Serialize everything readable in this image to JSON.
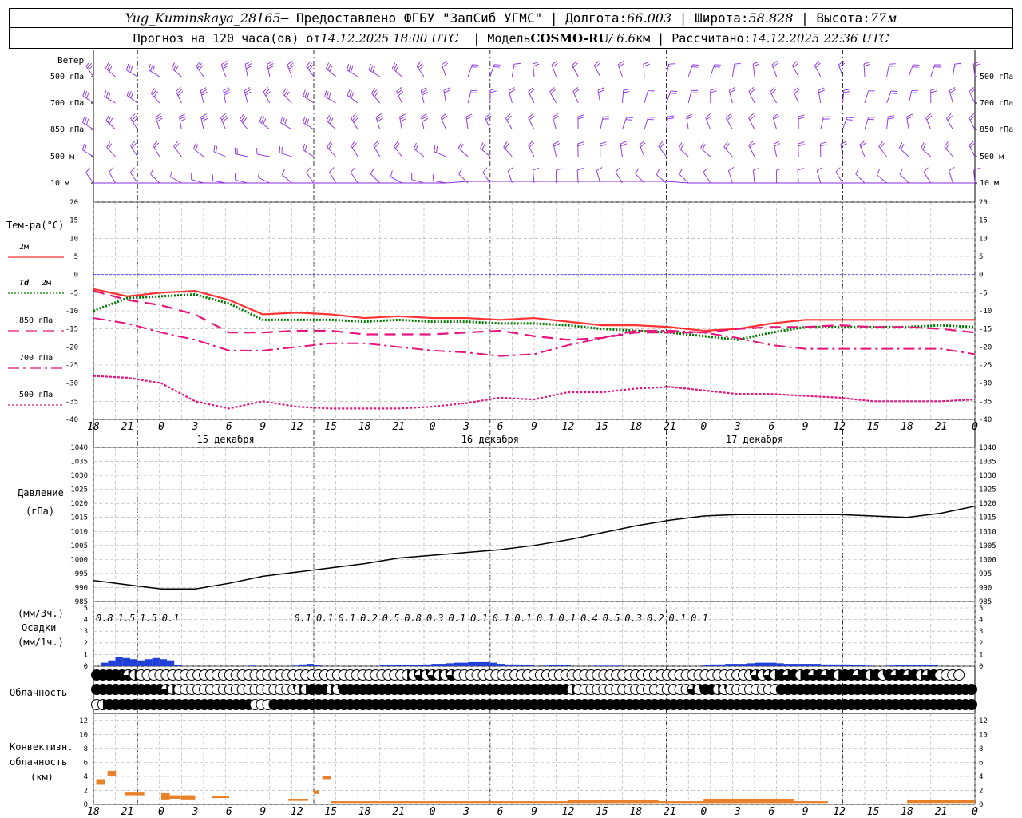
{
  "header": {
    "station": "Yug_Kuminskaya_28165",
    "provider": "— Предоставлено ФГБУ \"ЗапСиб УГМС\"",
    "lon_label": "Долгота:",
    "lon": "66.003",
    "lat_label": "Широта:",
    "lat": "58.828",
    "alt_label": "Высота:",
    "alt": "77м",
    "forecast_prefix": "Прогноз на 120 часа(ов) от",
    "forecast_time": "14.12.2025 18:00 UTC",
    "model_label": "Модель",
    "model": "COSMO-RU",
    "resolution": "/ 6.6",
    "resolution_unit": "км",
    "calc_label": "Рассчитано:",
    "calc_time": "14.12.2025 22:36 UTC"
  },
  "colors": {
    "wind": "#8a2be2",
    "t2m": "#ff3333",
    "td2m": "#007700",
    "t850": "#e6157d",
    "t700": "#e6157d",
    "t500": "#e6157d",
    "zero_line": "#3a3aff",
    "pressure": "#000000",
    "precip": "#1f3fd6",
    "convective": "#e8822a"
  },
  "icons": {
    "cloud_cover": "circle-fill-fraction",
    "wind": "wind-barb"
  },
  "chart_data": {
    "x_hours": [
      18,
      21,
      0,
      3,
      6,
      9,
      12,
      15,
      18,
      21,
      0,
      3,
      6,
      9,
      12,
      15,
      18,
      21,
      0,
      3,
      6,
      9,
      12,
      15,
      18,
      21,
      0
    ],
    "x_labels": [
      "18",
      "21",
      "0",
      "3",
      "6",
      "9",
      "12",
      "15",
      "18",
      "21",
      "0",
      "3",
      "6",
      "9",
      "12",
      "15",
      "18",
      "21",
      "0",
      "3",
      "6",
      "9",
      "12",
      "15",
      "18",
      "21",
      "0"
    ],
    "day_labels": [
      "15 декабря",
      "16 декабря",
      "17 декабря"
    ],
    "wind": {
      "title": "Ветер",
      "levels": [
        "500 гПа",
        "700 гПа",
        "850 гПа",
        "500 м",
        "10  м"
      ]
    },
    "temperature": {
      "type": "line",
      "title": "Тем-ра(°C)",
      "ylim": [
        -40,
        20
      ],
      "yticks": [
        20,
        15,
        10,
        5,
        0,
        -5,
        -10,
        -15,
        -20,
        -25,
        -30,
        -35,
        -40
      ],
      "legend": [
        {
          "name": "2м",
          "prefix": "",
          "style": "solid"
        },
        {
          "name": "2м",
          "prefix": "Td",
          "style": "dotted"
        },
        {
          "name": "850 гПа",
          "prefix": "",
          "style": "dash"
        },
        {
          "name": "700 гПа",
          "prefix": "",
          "style": "dashdot"
        },
        {
          "name": "500 гПа",
          "prefix": "",
          "style": "fine"
        }
      ],
      "series": {
        "t2m": [
          -4,
          -6,
          -5,
          -4.5,
          -7,
          -11,
          -10.5,
          -11,
          -12,
          -11.5,
          -12,
          -12,
          -12.5,
          -12,
          -13,
          -14,
          -14,
          -14.5,
          -15.5,
          -15,
          -13.5,
          -12.5,
          -12.5,
          -12.5,
          -12.5,
          -12.5,
          -12.5
        ],
        "td2m": [
          -10,
          -6.5,
          -6,
          -5.5,
          -8,
          -12.5,
          -12.5,
          -12.5,
          -13,
          -12.5,
          -13,
          -13,
          -13.5,
          -13.5,
          -14,
          -15,
          -15.5,
          -16,
          -17,
          -18,
          -16,
          -14.5,
          -14.5,
          -14.5,
          -14.5,
          -14,
          -14.5
        ],
        "t850": [
          -4.5,
          -7,
          -8.5,
          -11,
          -16,
          -16,
          -15.5,
          -15.5,
          -16.5,
          -16.5,
          -16.5,
          -16,
          -15.5,
          -17,
          -18,
          -17.5,
          -16,
          -16,
          -16,
          -15,
          -14.5,
          -14.5,
          -14,
          -14.5,
          -14.5,
          -15,
          -16
        ],
        "t700": [
          -12,
          -13.5,
          -16,
          -18,
          -21,
          -21,
          -20,
          -19,
          -19,
          -20,
          -21,
          -21.5,
          -22.5,
          -22,
          -19.5,
          -17.5,
          -15.5,
          -15.5,
          -16,
          -17.5,
          -19.5,
          -20.5,
          -20.5,
          -20.5,
          -20.5,
          -20.5,
          -22
        ],
        "t500": [
          -28,
          -28.5,
          -30,
          -35,
          -37,
          -35,
          -36.5,
          -37,
          -37,
          -37,
          -36.5,
          -35.5,
          -34,
          -34.5,
          -32.5,
          -32.5,
          -31.5,
          -31,
          -32,
          -33,
          -33,
          -33.5,
          -34,
          -35,
          -35,
          -35,
          -34.5
        ]
      }
    },
    "pressure": {
      "type": "line",
      "title": "Давление",
      "unit": "(гПа)",
      "ylim": [
        985,
        1040
      ],
      "yticks": [
        1040,
        1035,
        1030,
        1025,
        1020,
        1015,
        1010,
        1005,
        1000,
        995,
        990,
        985
      ],
      "values": [
        992.5,
        991,
        989.5,
        989.5,
        991.5,
        994,
        995.5,
        997,
        998.5,
        1000.5,
        1001.5,
        1002.5,
        1003.5,
        1005,
        1007,
        1009.5,
        1012,
        1014,
        1015.5,
        1016,
        1016,
        1016,
        1016,
        1015.5,
        1015,
        1016.5,
        1019
      ]
    },
    "precipitation": {
      "type": "bar",
      "unit_3h": "(мм/3ч.)",
      "title": "Осадки",
      "unit_1h": "(мм/1ч.)",
      "ylim": [
        0,
        5
      ],
      "yticks": [
        5,
        4,
        3,
        2,
        1,
        0
      ],
      "amount_labels": [
        "0.8",
        "1.5",
        "1.5",
        "0.1",
        "",
        "",
        "",
        "",
        "",
        "0.1",
        "0.1",
        "0.1",
        "0.2",
        "0.5",
        "0.8",
        "0.3",
        "0.1",
        "0.1",
        "0.1",
        "0.1",
        "0.1",
        "0.1",
        "0.4",
        "0.5",
        "0.3",
        "0.2",
        "0.1",
        "0.1"
      ],
      "hourly": [
        0,
        0.3,
        0.5,
        0.8,
        0.7,
        0.6,
        0.5,
        0.6,
        0.7,
        0.6,
        0.5,
        0.1,
        0,
        0,
        0,
        0,
        0,
        0,
        0,
        0,
        0,
        0.05,
        0,
        0,
        0,
        0,
        0,
        0.05,
        0.15,
        0.2,
        0.1,
        0,
        0,
        0,
        0,
        0,
        0,
        0,
        0,
        0.1,
        0.1,
        0.1,
        0.1,
        0.1,
        0.1,
        0.15,
        0.2,
        0.2,
        0.25,
        0.3,
        0.3,
        0.35,
        0.35,
        0.35,
        0.3,
        0.2,
        0.15,
        0.15,
        0.1,
        0.1,
        0,
        0.05,
        0.1,
        0.1,
        0.1,
        0,
        0,
        0,
        0.05,
        0.05,
        0.05,
        0.05,
        0,
        0,
        0,
        0,
        0,
        0,
        0,
        0,
        0,
        0,
        0,
        0.1,
        0.15,
        0.15,
        0.2,
        0.2,
        0.2,
        0.25,
        0.3,
        0.3,
        0.3,
        0.25,
        0.2,
        0.2,
        0.2,
        0.2,
        0.2,
        0.15,
        0.15,
        0.15,
        0.15,
        0.1,
        0.1,
        0.05,
        0,
        0,
        0.05,
        0.1,
        0.1,
        0.1,
        0.1,
        0.1,
        0.1
      ]
    },
    "cloud": {
      "title": "Облачность",
      "rows": [
        [
          1,
          1,
          1,
          1,
          1,
          0.75,
          0.5,
          0,
          0,
          0,
          0,
          0,
          0,
          0,
          0,
          0,
          0,
          0,
          0,
          0,
          0,
          0,
          0,
          0,
          0,
          0,
          0,
          0,
          0,
          0,
          0,
          0,
          0,
          0,
          0,
          0,
          0,
          0,
          0,
          0,
          0,
          0,
          0,
          0,
          0,
          0,
          0,
          0,
          0,
          0.5,
          0.25,
          0.75,
          0.25,
          0.75,
          0.5,
          0.25,
          0.75,
          0,
          0,
          0,
          0,
          0,
          0,
          0,
          0,
          0,
          0,
          0,
          0,
          0,
          0,
          0,
          0,
          0,
          0,
          0,
          0,
          0,
          0,
          0,
          0,
          0,
          0,
          0,
          0,
          0,
          0,
          0,
          0,
          0,
          0,
          0,
          0,
          0,
          0,
          0,
          0,
          0,
          0,
          0,
          0,
          0,
          0,
          0.25,
          0.75,
          0.25,
          0.75,
          0.5,
          1,
          0.75,
          1,
          0.5,
          1,
          0.75,
          1,
          0.75,
          1,
          0.5,
          1,
          1,
          0.75,
          1,
          0.5,
          1,
          0.25,
          1,
          0.75,
          1,
          0.75,
          1,
          0.5,
          0.75,
          1,
          0,
          0,
          0,
          0
        ],
        [
          1,
          1,
          1,
          1,
          1,
          1,
          1,
          1,
          1,
          1,
          1,
          0.75,
          0.5,
          0,
          0,
          0,
          0,
          0,
          0,
          0,
          0,
          0,
          0,
          0,
          0,
          0,
          0,
          0,
          0,
          0,
          0,
          0.25,
          0.5,
          0.5,
          1,
          1,
          1,
          0.5,
          0.25,
          1,
          1,
          1,
          1,
          1,
          1,
          1,
          1,
          1,
          1,
          1,
          1,
          1,
          1,
          1,
          1,
          1,
          1,
          1,
          1,
          1,
          1,
          1,
          1,
          1,
          1,
          1,
          1,
          1,
          1,
          1,
          1,
          1,
          1,
          1,
          1,
          0.5,
          0,
          0,
          0,
          0,
          0,
          0,
          0,
          0,
          0,
          0,
          0,
          0,
          0,
          0,
          0,
          0,
          0,
          0,
          0.75,
          0.25,
          1,
          1,
          0.5,
          0.25,
          0,
          0,
          0,
          0,
          0,
          0,
          0,
          0,
          1,
          1,
          1,
          1,
          1,
          1,
          1,
          1,
          1,
          1,
          1,
          1,
          1,
          1,
          1,
          1,
          1,
          1,
          1,
          1,
          1,
          1,
          1,
          1,
          1,
          1,
          1,
          1,
          1,
          1,
          1,
          1,
          1,
          1
        ],
        [
          0,
          0.5,
          1,
          1,
          1,
          1,
          1,
          1,
          1,
          1,
          1,
          1,
          1,
          1,
          1,
          1,
          1,
          1,
          1,
          1,
          1,
          1,
          1,
          1,
          1,
          0,
          0,
          0,
          1,
          1,
          1,
          1,
          1,
          1,
          1,
          1,
          1,
          1,
          1,
          1,
          1,
          1,
          1,
          1,
          1,
          1,
          1,
          1,
          1,
          1,
          1,
          1,
          1,
          1,
          1,
          1,
          1,
          1,
          1,
          1,
          1,
          1,
          1,
          1,
          1,
          1,
          1,
          1,
          1,
          1,
          1,
          1,
          1,
          1,
          1,
          1,
          1,
          1,
          1,
          1,
          1,
          1,
          1,
          1,
          1,
          1,
          1,
          1,
          1,
          1,
          1,
          1,
          1,
          1,
          1,
          1,
          1,
          1,
          1,
          1,
          1,
          1,
          1,
          1,
          1,
          1,
          1,
          1,
          1,
          1,
          1,
          1,
          1,
          1,
          1,
          1,
          1,
          1,
          1,
          1,
          1,
          1,
          1,
          1,
          1,
          1,
          1,
          1,
          1,
          1,
          1,
          1,
          1,
          1,
          1,
          1,
          1,
          1,
          1
        ]
      ]
    },
    "convective": {
      "type": "bar",
      "title": [
        "Конвективн.",
        "облачность",
        "(км)"
      ],
      "ylim": [
        0,
        13
      ],
      "yticks": [
        12,
        10,
        8,
        6,
        4,
        2,
        0
      ],
      "segments": [
        {
          "h0": 1,
          "h1": 4,
          "base": 2.8,
          "top": 3.6
        },
        {
          "h0": 5,
          "h1": 8,
          "base": 4.0,
          "top": 4.8
        },
        {
          "h0": 11,
          "h1": 18,
          "base": 1.3,
          "top": 1.7
        },
        {
          "h0": 24,
          "h1": 27,
          "base": 0.7,
          "top": 1.6
        },
        {
          "h0": 27,
          "h1": 31,
          "base": 0.8,
          "top": 1.3
        },
        {
          "h0": 31,
          "h1": 36,
          "base": 0.7,
          "top": 1.3
        },
        {
          "h0": 42,
          "h1": 48,
          "base": 0.9,
          "top": 1.2
        },
        {
          "h0": 69,
          "h1": 76,
          "base": 0.5,
          "top": 0.8
        },
        {
          "h0": 78,
          "h1": 80,
          "base": 1.5,
          "top": 2.0
        },
        {
          "h0": 81,
          "h1": 84,
          "base": 3.6,
          "top": 4.1
        },
        {
          "h0": 84,
          "h1": 260,
          "base": 0.2,
          "top": 0.45
        },
        {
          "h0": 168,
          "h1": 200,
          "base": 0.2,
          "top": 0.6
        },
        {
          "h0": 216,
          "h1": 248,
          "base": 0.2,
          "top": 0.8
        },
        {
          "h0": 288,
          "h1": 312,
          "base": 0.2,
          "top": 0.6
        }
      ]
    }
  }
}
